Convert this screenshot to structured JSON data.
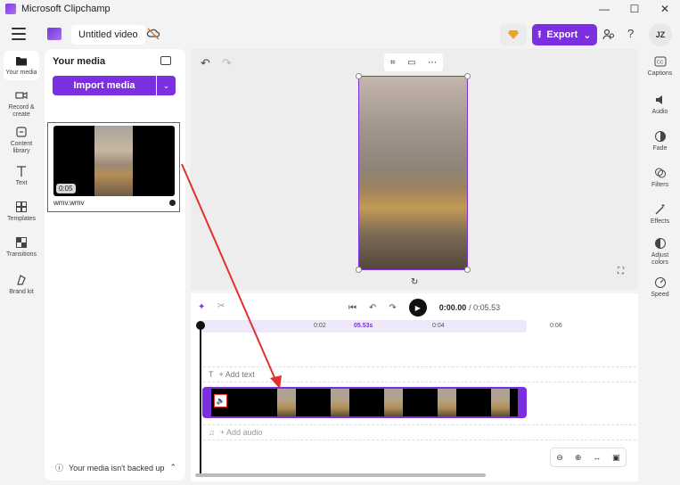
{
  "window": {
    "app_title": "Microsoft Clipchamp",
    "minimize": "—",
    "maximize": "☐",
    "close": "✕"
  },
  "header": {
    "project_title": "Untitled video",
    "export_label": "Export",
    "avatar_initials": "JZ",
    "help": "?"
  },
  "left_rail": {
    "items": [
      {
        "label": "Your media"
      },
      {
        "label": "Record &\ncreate"
      },
      {
        "label": "Content\nlibrary"
      },
      {
        "label": "Text"
      },
      {
        "label": "Templates"
      },
      {
        "label": "Transitions"
      },
      {
        "label": "Brand kit"
      }
    ]
  },
  "media_panel": {
    "title": "Your media",
    "import_label": "Import media",
    "item": {
      "duration": "0:05",
      "filename": "wmv.wmv"
    },
    "backup_status": "Your media isn't backed up"
  },
  "right_rail": {
    "items": [
      {
        "label": "Captions"
      },
      {
        "label": "Audio"
      },
      {
        "label": "Fade"
      },
      {
        "label": "Filters"
      },
      {
        "label": "Effects"
      },
      {
        "label": "Adjust\ncolors"
      },
      {
        "label": "Speed"
      }
    ]
  },
  "timeline": {
    "current_time": "0:00.00",
    "total_time": "/ 0:05.53",
    "ruler": {
      "t1": "0:02",
      "t2": "05.53s",
      "t3": "0:04",
      "t4": "0:06"
    },
    "add_text": "+ Add text",
    "add_audio": "+ Add audio"
  },
  "colors": {
    "accent": "#7c2fe0",
    "highlight_red": "#e03030"
  }
}
